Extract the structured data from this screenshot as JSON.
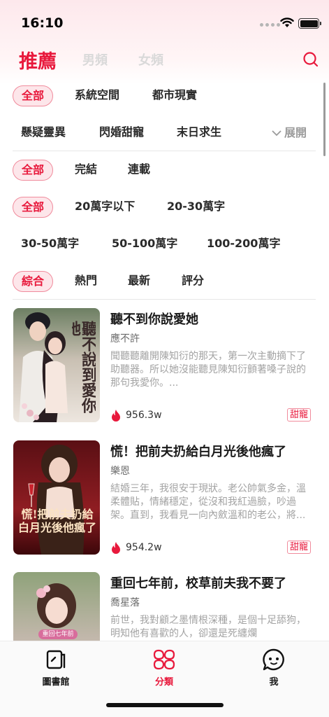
{
  "status_bar": {
    "time": "16:10"
  },
  "header": {
    "tabs": [
      {
        "label": "推薦",
        "active": true
      },
      {
        "label": "男頻",
        "active": false
      },
      {
        "label": "女頻",
        "active": false
      }
    ],
    "search_icon": "search-icon"
  },
  "filters": {
    "category": [
      "全部",
      "系統空間",
      "都市現實",
      "懸疑靈異",
      "閃婚甜寵",
      "末日求生"
    ],
    "expand_label": "展開",
    "status": [
      "全部",
      "完結",
      "連載"
    ],
    "word_count": [
      "全部",
      "20萬字以下",
      "20-30萬字",
      "30-50萬字",
      "50-100萬字",
      "100-200萬字"
    ],
    "sort": [
      "綜合",
      "熱門",
      "最新",
      "評分"
    ]
  },
  "books": [
    {
      "title": "聽不到你說愛她",
      "author": "應不許",
      "description": "聞聽聽離開陳知衍的那天，第一次主動摘下了助聽器。所以她沒能聽見陳知衍顫著嗓子說的那句我愛你。...",
      "heat": "956.3w",
      "tag": "甜寵",
      "cover_text": "聽不說到愛你她"
    },
    {
      "title": "慌！把前夫扔給白月光後他瘋了",
      "author": "樂恩",
      "description": "結婚三年，我很安于現狀。老公帥氣多金，溫柔體貼，情緒穩定，從沒和我紅過臉，吵過架。直到，我看見一向內斂溫和的老公，將...",
      "heat": "954.2w",
      "tag": "甜寵",
      "cover_text": "慌!把前夫扔給白月光後他瘋了"
    },
    {
      "title": "重回七年前，校草前夫我不要了",
      "author": "喬星落",
      "description": "前世，我對顧之墨情根深種，是個十足舔狗，明知他有喜歡的人，卻還是死纏爛",
      "heat": "",
      "tag": "",
      "cover_text": "重回七年前"
    }
  ],
  "bottom_nav": [
    {
      "label": "圖書館",
      "icon": "library-icon",
      "active": false
    },
    {
      "label": "分類",
      "icon": "category-icon",
      "active": true
    },
    {
      "label": "我",
      "icon": "profile-icon",
      "active": false
    }
  ],
  "colors": {
    "accent": "#e8193c",
    "chip_bg": "#fde6ea",
    "chip_border": "#f08b9c"
  }
}
